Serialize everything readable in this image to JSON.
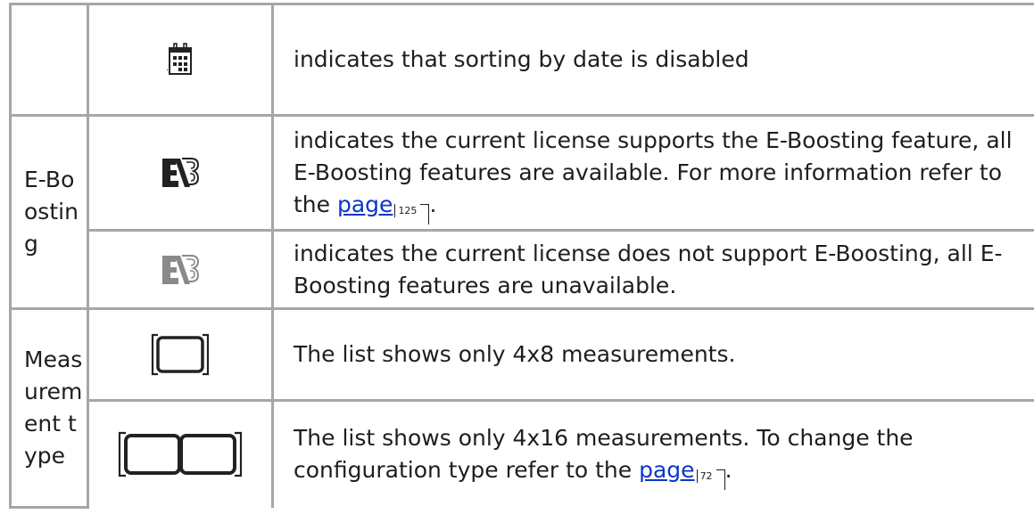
{
  "rows": {
    "calendar": {
      "category": "",
      "icon": "calendar-grid-icon",
      "description": "indicates that sorting by date is disabled"
    },
    "eboost_on": {
      "icon": "e-boosting-enabled-icon",
      "description_before": "indicates the current license supports the E-Boosting feature, all E-Boosting features are available. For more information refer to the ",
      "link_text": "page",
      "page_ref": "125",
      "description_after": "."
    },
    "eboost_off": {
      "icon": "e-boosting-disabled-icon",
      "description": "indicates the current license does not support E-Boosting, all E-Boosting features are unavailable."
    },
    "meas_4x8": {
      "icon": "single-frame-icon",
      "description": "The list shows only 4x8 measurements."
    },
    "meas_4x16": {
      "icon": "double-frame-icon",
      "description_before": "The list shows only 4x16 measurements. To change the configuration type refer to the ",
      "link_text": "page",
      "page_ref": "72",
      "description_after": "."
    }
  },
  "categories": {
    "eboosting": "E-Boosting",
    "measurement": "Measurement type"
  },
  "colors": {
    "border": "#a6a6a6",
    "link": "#0a36c8",
    "icon_dark": "#222222",
    "icon_gray": "#8a8a8a"
  }
}
